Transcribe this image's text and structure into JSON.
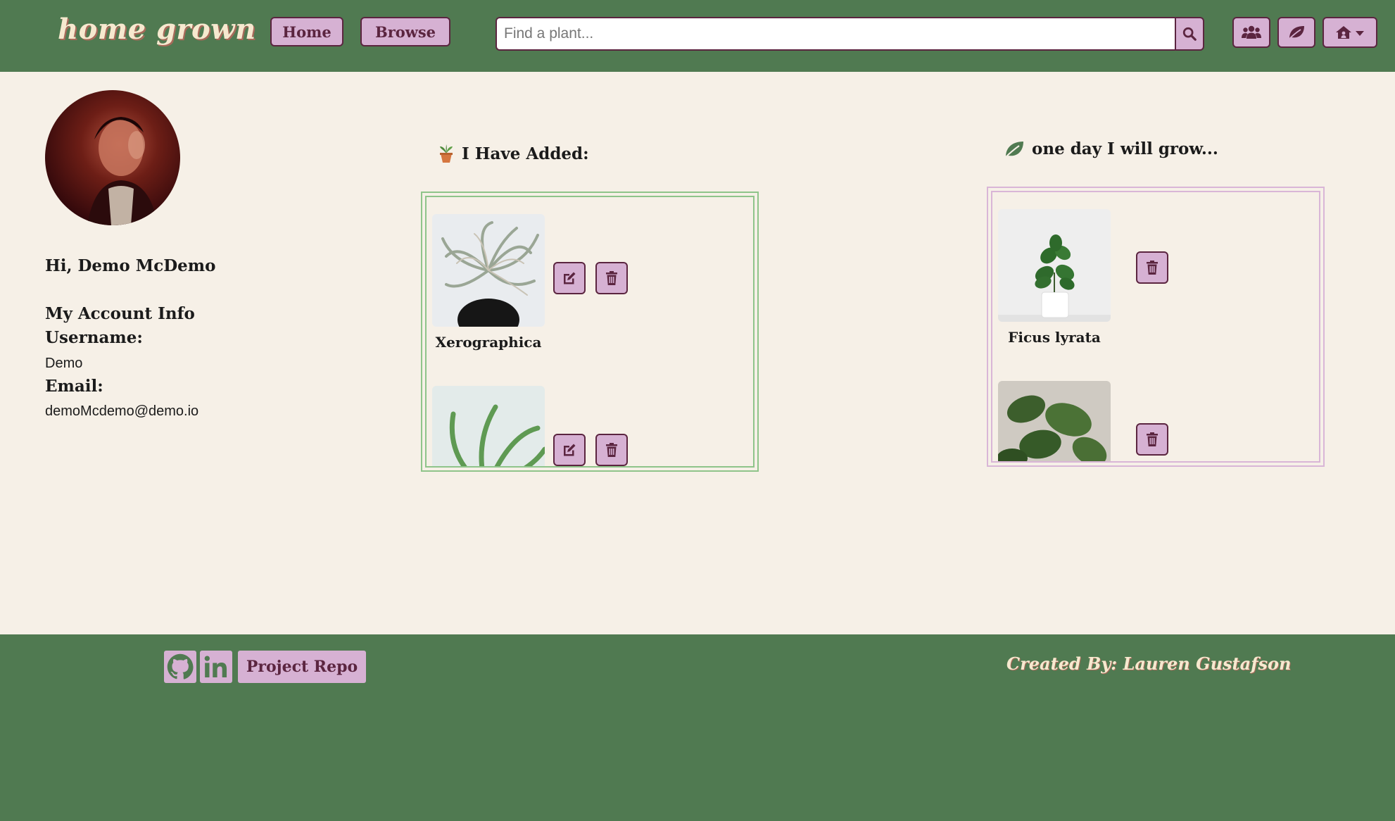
{
  "nav": {
    "logo": "home grown",
    "home_label": "Home",
    "browse_label": "Browse",
    "search_placeholder": "Find a plant...",
    "icons": [
      "users-icon",
      "leaf-icon",
      "home-user-dropdown-icon"
    ]
  },
  "profile": {
    "greeting": "Hi, Demo McDemo",
    "account_heading": "My Account Info",
    "username_label": "Username:",
    "username": "Demo",
    "email_label": "Email:",
    "email": "demoMcdemo@demo.io"
  },
  "added": {
    "heading": "I Have Added:",
    "icon": "potted-plant-icon",
    "items": [
      {
        "name": "Xerographica"
      },
      {
        "name": ""
      }
    ]
  },
  "wishlist": {
    "heading": "one day I will grow...",
    "icon": "leaf-icon",
    "items": [
      {
        "name": "Ficus lyrata"
      },
      {
        "name": ""
      }
    ]
  },
  "footer": {
    "repo_label": "Project Repo",
    "credit": "Created By: Lauren Gustafson",
    "icons": [
      "github-icon",
      "linkedin-icon"
    ]
  },
  "colors": {
    "primary_green": "#507a51",
    "accent_pink": "#d6b1d3",
    "border_plum": "#5b2540",
    "cream_bg": "#f6f0e7"
  }
}
